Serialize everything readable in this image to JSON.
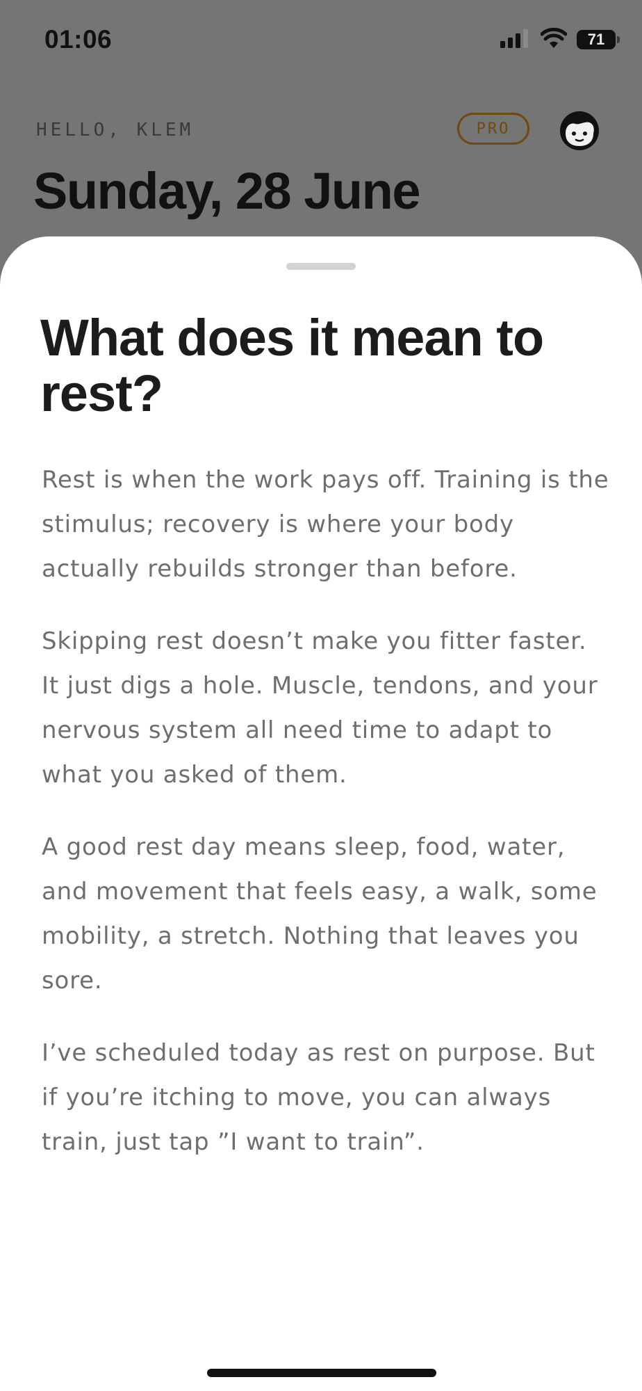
{
  "status_bar": {
    "time": "01:06",
    "battery_level": "71"
  },
  "header": {
    "greeting": "HELLO, KLEM",
    "badge": "PRO",
    "date": "Sunday, 28 June"
  },
  "sheet": {
    "title": "What does it mean to rest?",
    "paragraphs": [
      "Rest is when the work pays off. Training is the stimulus; recovery is where your body actually rebuilds stronger than before.",
      "Skipping rest doesn’t make you fitter faster. It just digs a hole. Muscle, tendons, and your nervous system all need time to adapt to what you asked of them.",
      "A good rest day means sleep, food, water, and movement that feels easy, a walk, some mobility, a stretch. Nothing that leaves you sore.",
      "I’ve scheduled today as rest on purpose. But if you’re itching to move, you can always train, just tap ”I want to train”."
    ]
  },
  "colors": {
    "background_dim": "#757575",
    "sheet": "#ffffff",
    "pro_accent": "#6f4a0e",
    "body_text": "#6e6e6e",
    "title_text": "#1c1c1c"
  },
  "icons": [
    "cellular-signal-icon",
    "wifi-icon",
    "battery-icon",
    "avatar-face-icon"
  ]
}
